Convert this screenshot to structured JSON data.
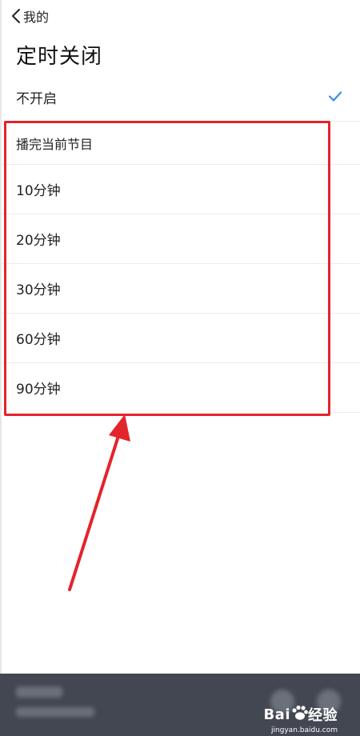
{
  "nav": {
    "back_label": "我的"
  },
  "page": {
    "title": "定时关闭"
  },
  "options": [
    {
      "label": "不开启",
      "selected": true
    },
    {
      "label": "播完当前节目",
      "selected": false
    },
    {
      "label": "10分钟",
      "selected": false
    },
    {
      "label": "20分钟",
      "selected": false
    },
    {
      "label": "30分钟",
      "selected": false
    },
    {
      "label": "60分钟",
      "selected": false
    },
    {
      "label": "90分钟",
      "selected": false
    }
  ],
  "colors": {
    "accent": "#3b8beb",
    "annotation": "#e3242b",
    "player_bg": "#424751"
  },
  "watermark": {
    "brand": "Bai",
    "brand2": "经验",
    "url": "jingyan.baidu.com"
  }
}
